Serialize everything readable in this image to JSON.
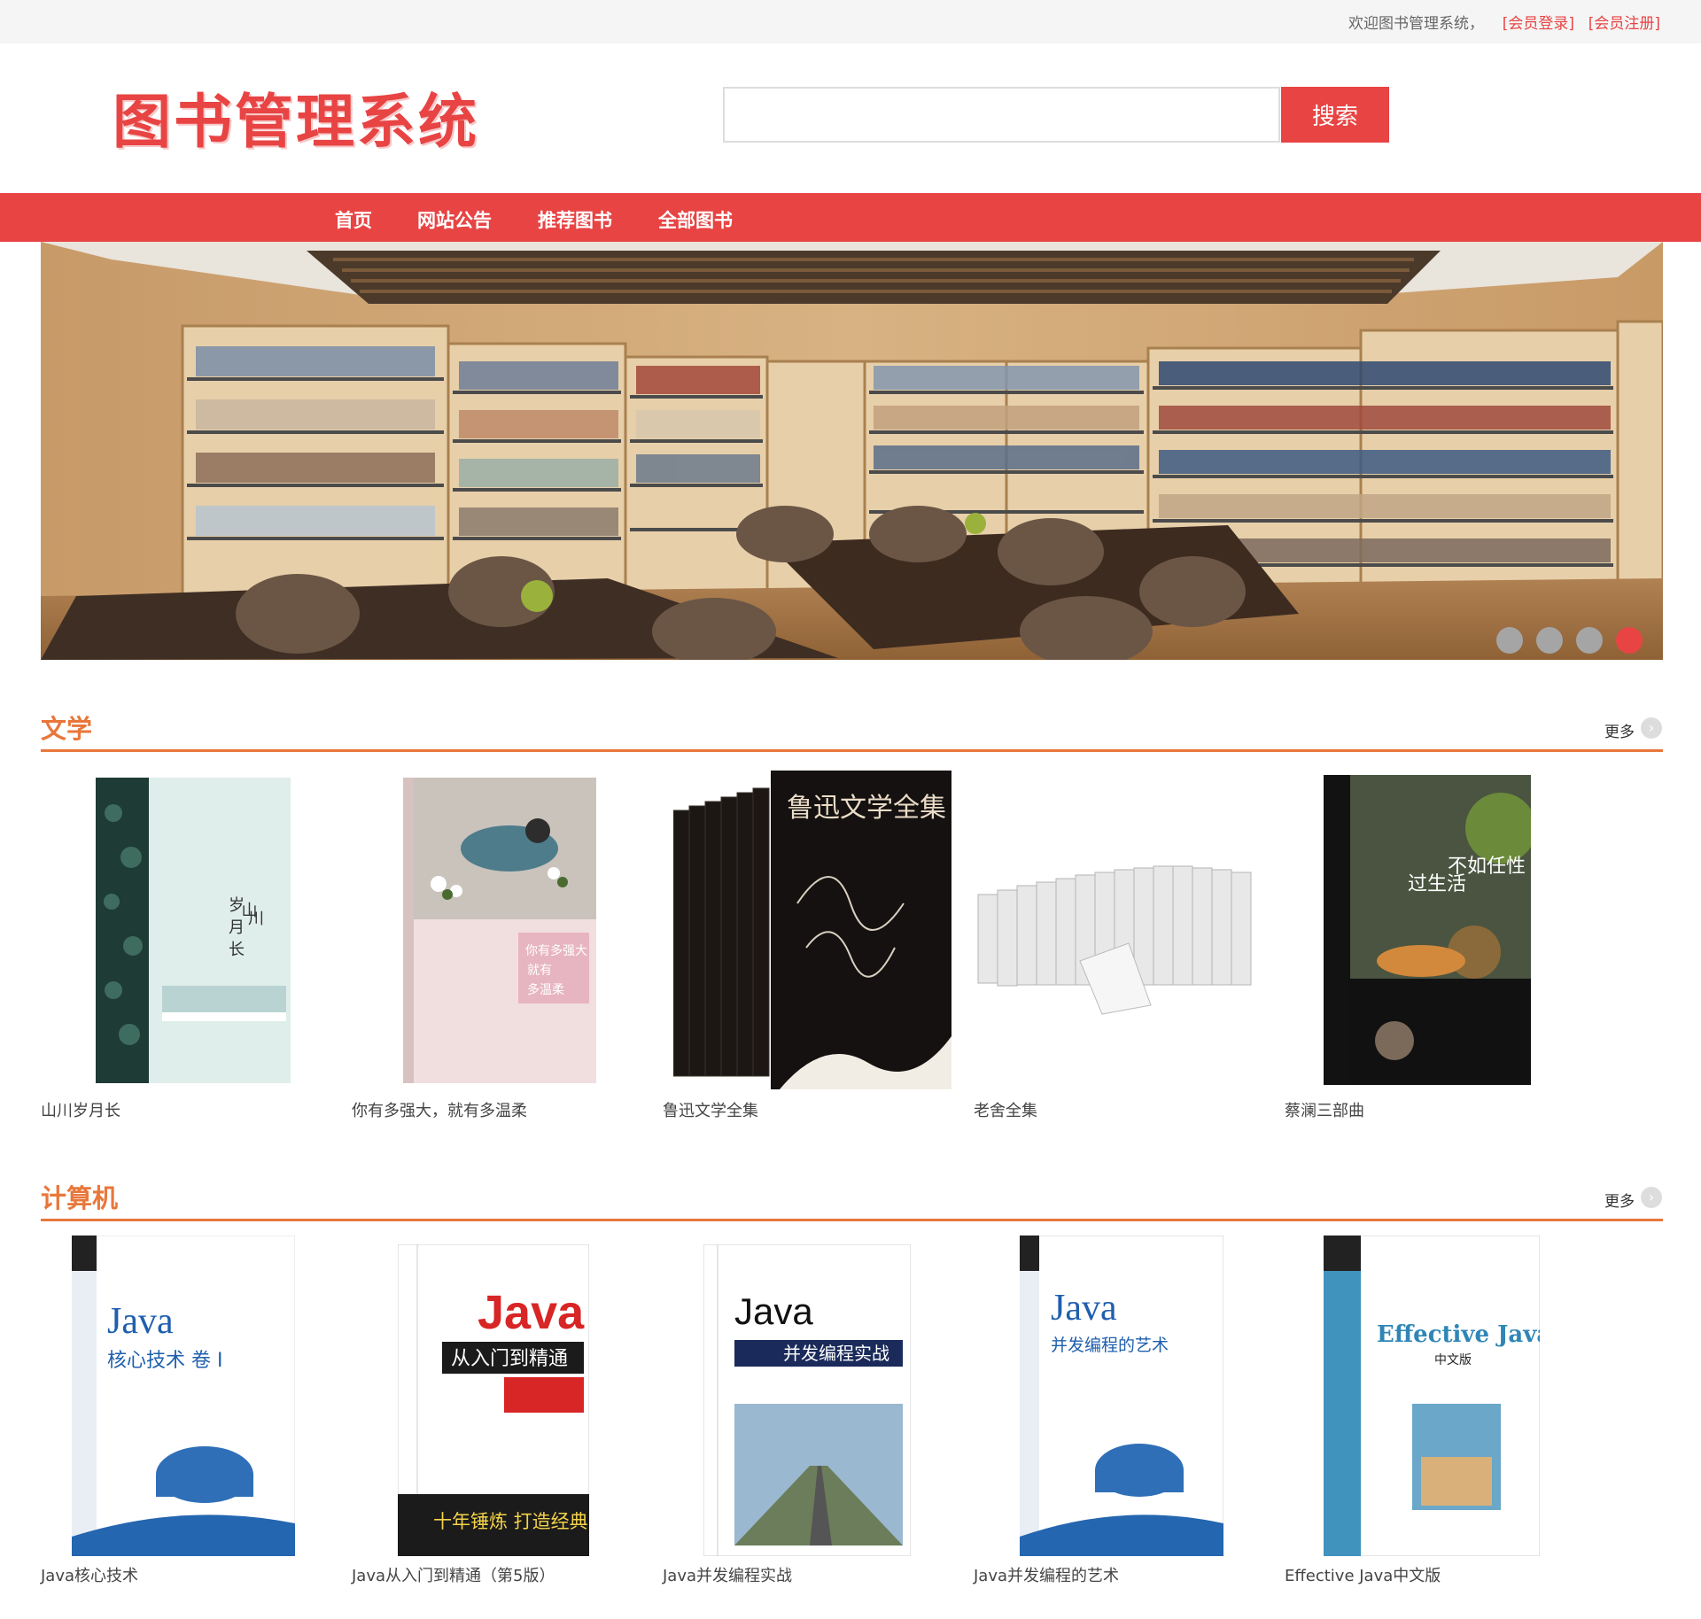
{
  "topbar": {
    "welcome": "欢迎图书管理系统，",
    "login": "[会员登录]",
    "register": "[会员注册]"
  },
  "header": {
    "logo": "图书管理系统",
    "search_placeholder": "",
    "search_button": "搜索"
  },
  "nav": {
    "items": [
      "首页",
      "网站公告",
      "推荐图书",
      "全部图书"
    ]
  },
  "banner": {
    "dots": 4,
    "active_dot": 4,
    "colors": {
      "wood": "#c9a275",
      "ceiling": "#4b3a2a",
      "table": "#3f2e24"
    }
  },
  "sections": [
    {
      "title": "文学",
      "more": "更多",
      "books": [
        {
          "title": "山川岁月长",
          "cover_text": "山川岁月长"
        },
        {
          "title": "你有多强大，就有多温柔",
          "cover_text": "你有多强大 就有 多温柔"
        },
        {
          "title": "鲁迅文学全集",
          "cover_text": "鲁迅文学全集"
        },
        {
          "title": "老舍全集",
          "cover_text": ""
        },
        {
          "title": "蔡澜三部曲",
          "cover_text": "不如任性过生活"
        }
      ]
    },
    {
      "title": "计算机",
      "more": "更多",
      "books": [
        {
          "title": "Java核心技术",
          "cover_text": "Java",
          "cover_sub": "核心技术 卷 I"
        },
        {
          "title": "Java从入门到精通（第5版）",
          "cover_text": "Java",
          "cover_sub": "从入门到精通",
          "cover_band": "十年锤炼 打造经典"
        },
        {
          "title": "Java并发编程实战",
          "cover_text": "Java",
          "cover_sub": "并发编程实战"
        },
        {
          "title": "Java并发编程的艺术",
          "cover_text": "Java",
          "cover_sub": "并发编程的艺术"
        },
        {
          "title": "Effective Java中文版",
          "cover_text": "Effective Java",
          "cover_sub": "中文版"
        }
      ]
    }
  ],
  "colors": {
    "brand_red": "#e84444",
    "section_orange": "#e8773b"
  }
}
